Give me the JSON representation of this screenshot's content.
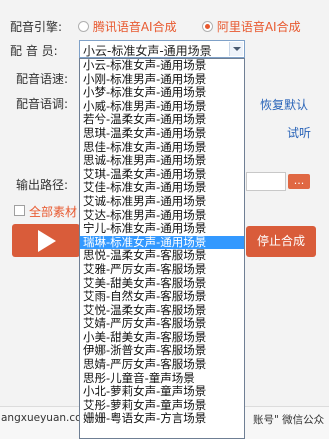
{
  "engine": {
    "label": "配音引擎:",
    "options": [
      {
        "label": "腾讯语音AI合成",
        "selected": false
      },
      {
        "label": "阿里语音AI合成",
        "selected": true
      }
    ]
  },
  "voice": {
    "label": "配 音 员:",
    "selected": "小云-标准女声-通用场景",
    "options": [
      "小云-标准女声-通用场景",
      "小刚-标准男声-通用场景",
      "小梦-标准女声-通用场景",
      "小威-标准男声-通用场景",
      "若兮-温柔女声-通用场景",
      "思琪-温柔女声-通用场景",
      "思佳-标准女声-通用场景",
      "思诚-标准男声-通用场景",
      "艾琪-温柔女声-通用场景",
      "艾佳-标准女声-通用场景",
      "艾诚-标准男声-通用场景",
      "艾达-标准男声-通用场景",
      "宁儿-标准女声-通用场景",
      "瑞琳-标准女声-通用场景",
      "思悦-温柔女声-客服场景",
      "艾雅-严厉女声-客服场景",
      "艾美-甜美女声-客服场景",
      "艾雨-自然女声-客服场景",
      "艾悦-温柔女声-客服场景",
      "艾婧-严厉女声-客服场景",
      "小美-甜美女声-客服场景",
      "伊娜-浙普女声-客服场景",
      "思婧-严厉女声-客服场景",
      "思彤-儿童音-童声场景",
      "小北-萝莉女声-童声场景",
      "艾彤-萝莉女声-童声场景",
      "姗姗-粤语女声-方言场景"
    ],
    "highlighted_index": 13
  },
  "rate": {
    "label": "配音语速:"
  },
  "pitch": {
    "label": "配音语调:"
  },
  "restore_default": "恢复默认",
  "audition": "试听",
  "output": {
    "label": "输出路径:",
    "browse": "..."
  },
  "select_all": {
    "label": "全部素材"
  },
  "stop_button": "停止合成",
  "footer": {
    "watermark_left": "angxueyuan.com",
    "watermark_right": "账号\" 微信公众"
  },
  "colors": {
    "accent": "#e8592f",
    "selection": "#3399ff",
    "button": "#d95c3a"
  }
}
